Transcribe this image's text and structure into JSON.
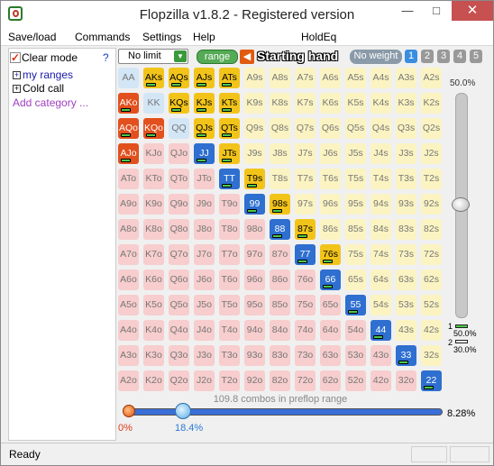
{
  "title": "Flopzilla v1.8.2 - Registered version",
  "window": {
    "minimize": "—",
    "maximize": "□",
    "close": "✕"
  },
  "menu": [
    "Save/load",
    "Commands",
    "Settings",
    "Help",
    "HoldEq"
  ],
  "left": {
    "clear_mode": "Clear mode",
    "help": "?",
    "items": [
      "my ranges",
      "Cold call"
    ],
    "add_category": "Add category ..."
  },
  "toolbar": {
    "limit": "No limit",
    "range": "range",
    "starting_hand": "Starting hand",
    "no_weight": "No weight",
    "weights": [
      "1",
      "2",
      "3",
      "4",
      "5"
    ]
  },
  "ranks": [
    "A",
    "K",
    "Q",
    "J",
    "T",
    "9",
    "8",
    "7",
    "6",
    "5",
    "4",
    "3",
    "2"
  ],
  "selected_hands": [
    "AKs",
    "AQs",
    "AJs",
    "ATs",
    "AKo",
    "KQs",
    "KJs",
    "KTs",
    "AQo",
    "KQo",
    "QJs",
    "QTs",
    "AJo",
    "JJ",
    "JTs",
    "TT",
    "T9s",
    "99",
    "98s",
    "88",
    "87s",
    "77",
    "76s",
    "66",
    "55",
    "44",
    "33",
    "22"
  ],
  "slider": {
    "top_pct": "50.0%",
    "w1": "1",
    "w1_val": "50.0%",
    "w2": "2",
    "w2_val": "30.0%",
    "vertical_level_pct": 50
  },
  "combos_text": "109.8 combos in preflop range",
  "range_pct": "8.28%",
  "range_min": "0%",
  "range_thumb": "18.4%",
  "status": "Ready"
}
